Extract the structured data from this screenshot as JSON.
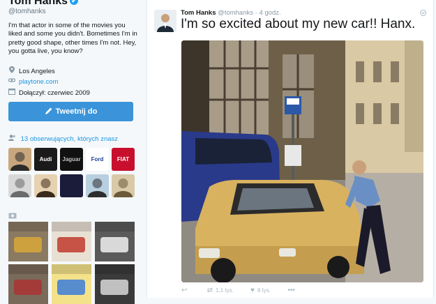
{
  "profile": {
    "name": "Tom Hanks",
    "verified_mark": "✔",
    "handle": "@tomhanks",
    "bio": "I'm that actor in some of the movies you liked and some you didn't. Bometimes I'm in pretty good shape, other times I'm not. Hey, you gotta live, you know?",
    "location": "Los Angeles",
    "website": "playtone.com",
    "joined": "Dołączył: czerwiec 2009",
    "icons": {
      "location": "location-pin-icon",
      "link": "link-icon",
      "calendar": "calendar-icon"
    }
  },
  "tweet_button": {
    "label": "Tweetnij do",
    "icon": "compose-icon"
  },
  "followers_you_know": {
    "label": "13 obserwujących, których znasz",
    "icon": "people-icon"
  },
  "follower_avatars": [
    {
      "kind": "person",
      "bg": "#c9a77e",
      "fg": "#2b2b2b"
    },
    {
      "kind": "logo",
      "label": "Audi",
      "bg": "#1a1a1a",
      "fg": "#ffffff"
    },
    {
      "kind": "logo",
      "label": "Jaguar",
      "bg": "#111111",
      "fg": "#c0c0c0"
    },
    {
      "kind": "logo",
      "label": "Ford",
      "bg": "#ffffff",
      "fg": "#1c3f94"
    },
    {
      "kind": "logo",
      "label": "FIAT",
      "bg": "#c8102e",
      "fg": "#ffffff"
    },
    {
      "kind": "person",
      "bg": "#d8d8d8",
      "fg": "#6b6b6b"
    },
    {
      "kind": "person",
      "bg": "#e6d2b0",
      "fg": "#3a2a1c"
    },
    {
      "kind": "logo",
      "label": "",
      "bg": "#1b1b3a",
      "fg": "#e63946"
    },
    {
      "kind": "person",
      "bg": "#b8cfe0",
      "fg": "#2d2d2d"
    },
    {
      "kind": "person",
      "bg": "#d9c9a8",
      "fg": "#6b5a3a"
    }
  ],
  "media_icon": "photo-icon",
  "media_thumbs": [
    {
      "bg": "#8a7a62",
      "accent": "#d8a838"
    },
    {
      "bg": "#e9e0d4",
      "accent": "#c0392b"
    },
    {
      "bg": "#5a5a5a",
      "accent": "#f0f0f0"
    },
    {
      "bg": "#7a6a5a",
      "accent": "#a33"
    },
    {
      "bg": "#f4e28a",
      "accent": "#3b7dd8"
    },
    {
      "bg": "#3a3a3a",
      "accent": "#d8d8d8"
    }
  ],
  "tweet": {
    "author": "Tom Hanks",
    "handle": "@tomhanks",
    "time": "4 godz.",
    "text": "I'm so excited about my new car!! Hanx.",
    "chevron_icon": "chevron-down-icon",
    "actions": [
      {
        "icon": "reply-icon",
        "glyph": "↩",
        "count": ""
      },
      {
        "icon": "retweet-icon",
        "glyph": "⇄",
        "count": "1,1 tys."
      },
      {
        "icon": "heart-icon",
        "glyph": "♥",
        "count": "8 tys."
      },
      {
        "icon": "more-icon",
        "glyph": "•••",
        "count": ""
      }
    ]
  },
  "colors": {
    "accent": "#1da1f2",
    "button": "#3b94d9",
    "link": "#1b95e0",
    "car": "#d9b25f"
  }
}
